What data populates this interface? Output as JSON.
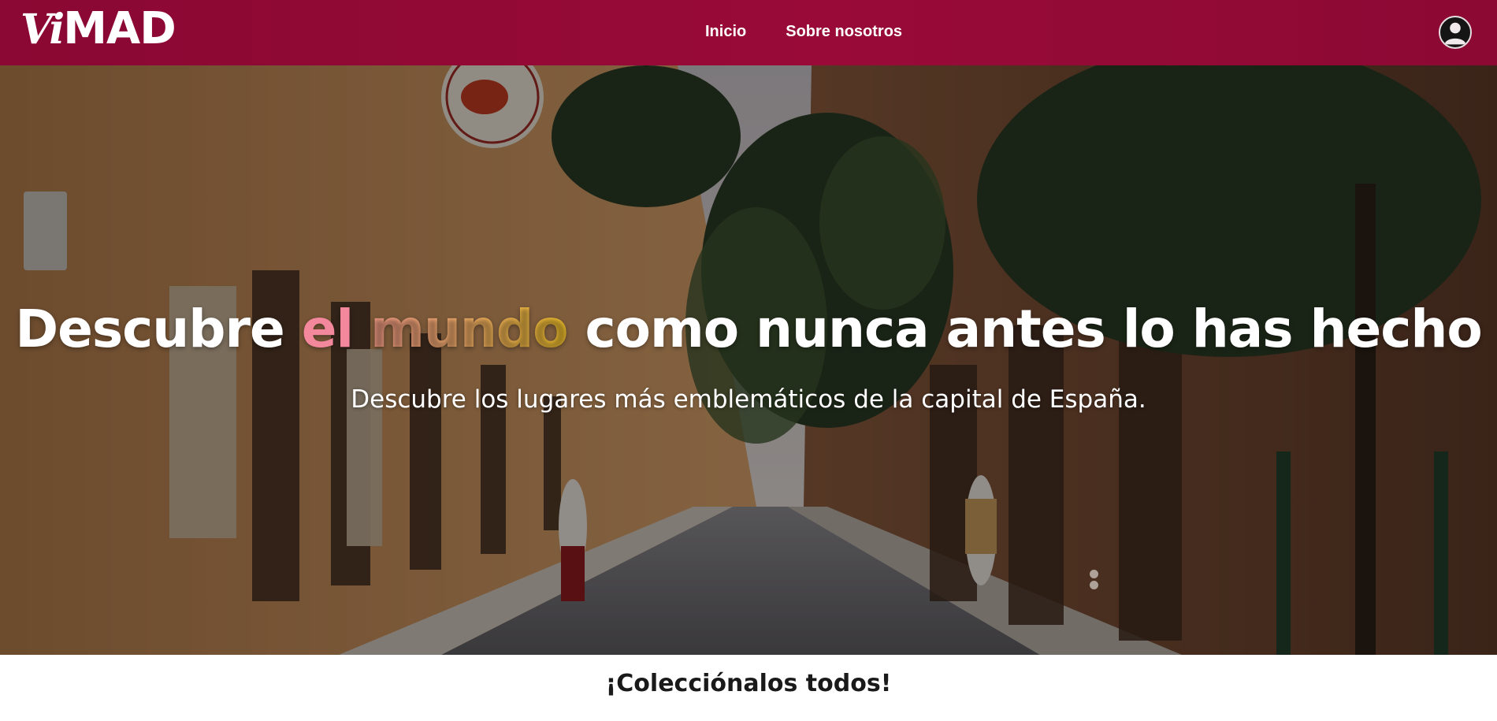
{
  "brand": {
    "logo_vi": "Vi",
    "logo_mad": "MAD",
    "primary_color": "#8a0833"
  },
  "nav": {
    "links": [
      {
        "label": "Inicio"
      },
      {
        "label": "Sobre nosotros"
      }
    ],
    "user_icon": "user-avatar-icon"
  },
  "hero": {
    "title_before": "Descubre ",
    "title_el": "el",
    "title_mundo": "mundo",
    "title_after": " como nunca antes lo has hecho",
    "subtitle": "Descubre los lugares más emblemáticos de la capital de España.",
    "background": "madrid-street-photo",
    "accent_colors": [
      "#f3889c",
      "#f4ae6c",
      "#f3c22c"
    ],
    "carousel_slides": 2
  },
  "collections": {
    "heading": "¡Colecciónalos todos!"
  }
}
